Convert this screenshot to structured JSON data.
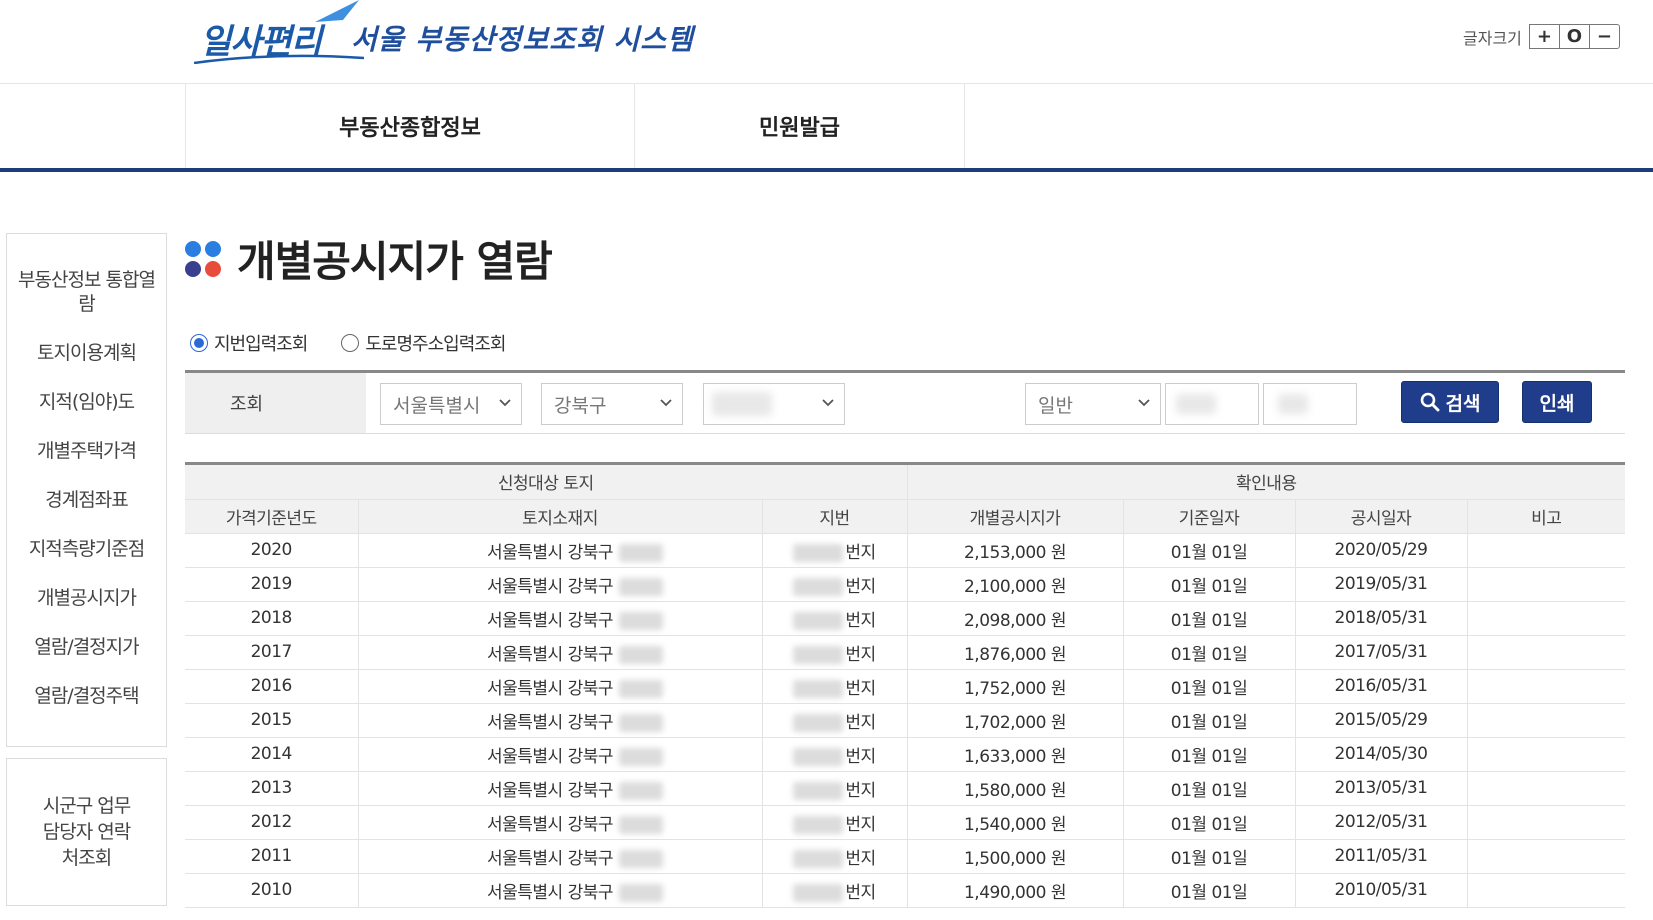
{
  "header": {
    "logo_text": "일사편리",
    "system_title": "서울 부동산정보조회 시스템",
    "font_size_label": "글자크기",
    "font_buttons": [
      "+",
      "O",
      "−"
    ]
  },
  "nav": {
    "items": [
      "부동산종합정보",
      "민원발급"
    ]
  },
  "sidebar": {
    "items": [
      "부동산정보 통합열람",
      "토지이용계획",
      "지적(임야)도",
      "개별주택가격",
      "경계점좌표",
      "지적측량기준점",
      "개별공시지가",
      "열람/결정지가",
      "열람/결정주택"
    ],
    "contact": "시군구 업무담당자 연락처조회"
  },
  "main": {
    "title": "개별공시지가 열람",
    "dot_colors": [
      "#2a7de1",
      "#2a7de1",
      "#3a3f8f",
      "#e84c3d"
    ],
    "radio": {
      "options": [
        "지번입력조회",
        "도로명주소입력조회"
      ],
      "selected": "지번입력조회"
    },
    "search": {
      "label": "조회",
      "city": "서울특별시",
      "gu": "강북구",
      "type": "일반",
      "search_button": "검색",
      "print_button": "인쇄"
    },
    "table": {
      "group_headers": [
        "신청대상 토지",
        "확인내용"
      ],
      "columns": [
        "가격기준년도",
        "토지소재지",
        "지번",
        "개별공시지가",
        "기준일자",
        "공시일자",
        "비고"
      ],
      "location_prefix": "서울특별시 강북구",
      "jibun_suffix": "번지",
      "rows": [
        {
          "year": "2020",
          "price": "2,153,000 원",
          "base_date": "01월 01일",
          "notice_date": "2020/05/29",
          "note": ""
        },
        {
          "year": "2019",
          "price": "2,100,000 원",
          "base_date": "01월 01일",
          "notice_date": "2019/05/31",
          "note": ""
        },
        {
          "year": "2018",
          "price": "2,098,000 원",
          "base_date": "01월 01일",
          "notice_date": "2018/05/31",
          "note": ""
        },
        {
          "year": "2017",
          "price": "1,876,000 원",
          "base_date": "01월 01일",
          "notice_date": "2017/05/31",
          "note": ""
        },
        {
          "year": "2016",
          "price": "1,752,000 원",
          "base_date": "01월 01일",
          "notice_date": "2016/05/31",
          "note": ""
        },
        {
          "year": "2015",
          "price": "1,702,000 원",
          "base_date": "01월 01일",
          "notice_date": "2015/05/29",
          "note": ""
        },
        {
          "year": "2014",
          "price": "1,633,000 원",
          "base_date": "01월 01일",
          "notice_date": "2014/05/30",
          "note": ""
        },
        {
          "year": "2013",
          "price": "1,580,000 원",
          "base_date": "01월 01일",
          "notice_date": "2013/05/31",
          "note": ""
        },
        {
          "year": "2012",
          "price": "1,540,000 원",
          "base_date": "01월 01일",
          "notice_date": "2012/05/31",
          "note": ""
        },
        {
          "year": "2011",
          "price": "1,500,000 원",
          "base_date": "01월 01일",
          "notice_date": "2011/05/31",
          "note": ""
        },
        {
          "year": "2010",
          "price": "1,490,000 원",
          "base_date": "01월 01일",
          "notice_date": "2010/05/31",
          "note": ""
        }
      ]
    }
  }
}
